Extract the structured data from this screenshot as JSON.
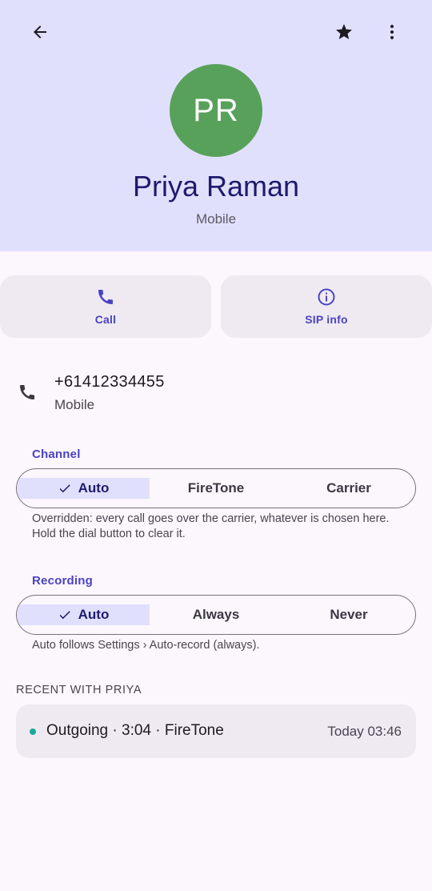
{
  "header": {
    "avatar_initials": "PR",
    "name": "Priya Raman",
    "type": "Mobile",
    "icons": {
      "back": "arrow-back-icon",
      "favorite": "star-icon",
      "more": "more-vert-icon"
    },
    "background": "#e0e0fd",
    "avatar_color": "#58a15a"
  },
  "actions": [
    {
      "label": "Call",
      "icon": "phone-icon"
    },
    {
      "label": "SIP info",
      "icon": "info-icon"
    }
  ],
  "phone": {
    "number": "+61412334455",
    "type": "Mobile",
    "icon": "phone-icon"
  },
  "channel": {
    "label": "Channel",
    "options": [
      "Auto",
      "FireTone",
      "Carrier"
    ],
    "selected": "Auto",
    "help": "Overridden: every call goes over the carrier, whatever is chosen here. Hold the dial button to clear it."
  },
  "recording": {
    "label": "Recording",
    "options": [
      "Auto",
      "Always",
      "Never"
    ],
    "selected": "Auto",
    "help": "Auto follows Settings › Auto-record (always)."
  },
  "recent": {
    "title": "RECENT WITH PRIYA",
    "items": [
      {
        "description": "Outgoing · 3:04 · FireTone",
        "time": "Today 03:46",
        "dot_color": "#1ba99b"
      }
    ]
  },
  "colors": {
    "accent": "#4a43c2",
    "name": "#1f1a6e",
    "page_bg": "#fcf6fd",
    "card_bg": "#efeaf2"
  }
}
